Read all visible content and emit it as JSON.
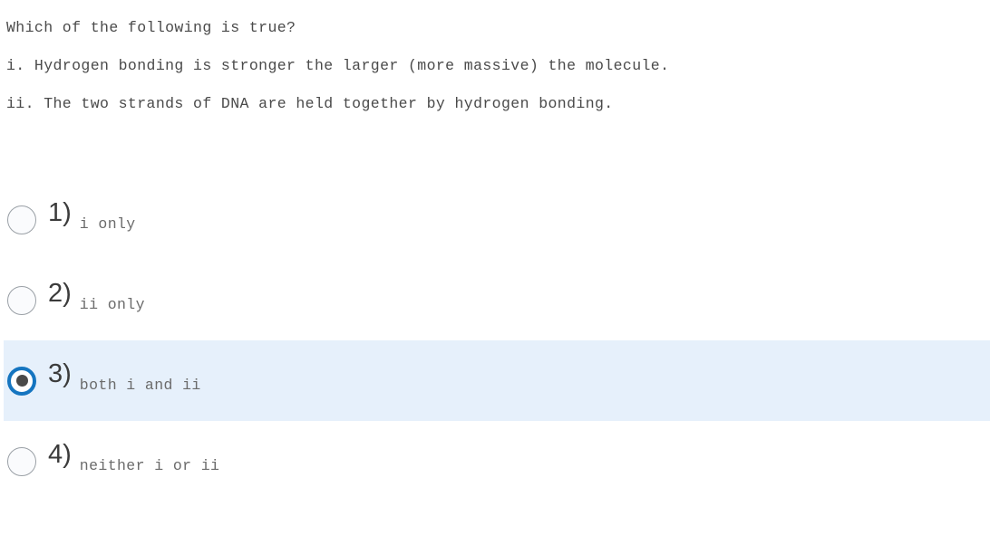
{
  "question": {
    "lines": [
      "Which of the following is true?",
      "i. Hydrogen bonding is stronger the larger (more massive) the molecule.",
      "ii. The two strands of DNA are held together by hydrogen bonding."
    ]
  },
  "options": [
    {
      "number": "1)",
      "label": "i only",
      "selected": false,
      "radio_icon": "radio-unchecked-icon"
    },
    {
      "number": "2)",
      "label": "ii only",
      "selected": false,
      "radio_icon": "radio-unchecked-icon"
    },
    {
      "number": "3)",
      "label": "both i and ii",
      "selected": true,
      "radio_icon": "radio-checked-icon"
    },
    {
      "number": "4)",
      "label": "neither i or ii",
      "selected": false,
      "radio_icon": "radio-unchecked-icon"
    }
  ],
  "colors": {
    "page_background": "#ffffff",
    "stem_text": "#4a4a4a",
    "option_number_text": "#3b3b3b",
    "option_label_text": "#6b6b6b",
    "selected_row_background": "#e6f0fb",
    "selected_radio_ring": "#1575c0",
    "selected_radio_dot": "#4a4a4a",
    "unselected_radio_border": "#9aa0a6",
    "unselected_radio_fill": "#fafbfd"
  }
}
